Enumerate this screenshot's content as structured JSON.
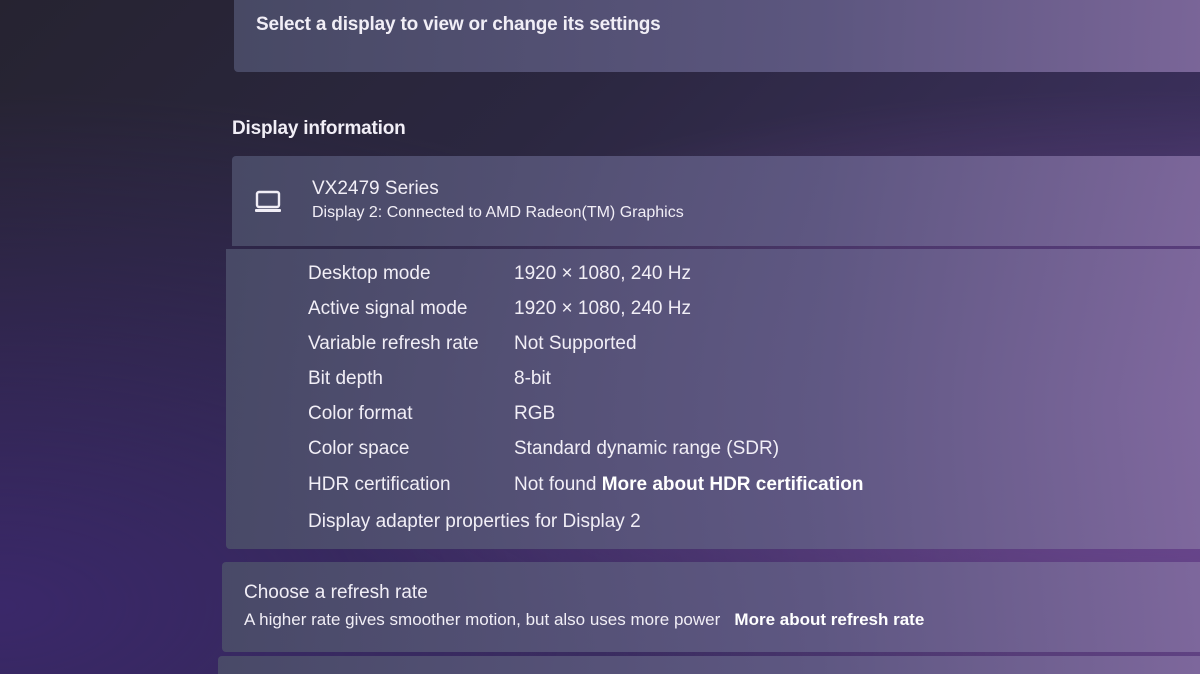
{
  "header": {
    "select_display_text": "Select a display to view or change its settings"
  },
  "display_info": {
    "heading": "Display information",
    "monitor": {
      "icon": "monitor-icon",
      "name": "VX2479 Series",
      "connection": "Display 2: Connected to AMD Radeon(TM) Graphics"
    },
    "rows": [
      {
        "label": "Desktop mode",
        "value": "1920 × 1080, 240 Hz"
      },
      {
        "label": "Active signal mode",
        "value": "1920 × 1080, 240 Hz"
      },
      {
        "label": "Variable refresh rate",
        "value": "Not Supported"
      },
      {
        "label": "Bit depth",
        "value": "8-bit"
      },
      {
        "label": "Color format",
        "value": "RGB"
      },
      {
        "label": "Color space",
        "value": "Standard dynamic range (SDR)"
      },
      {
        "label": "HDR certification",
        "value": "Not found",
        "link": "More about HDR certification"
      }
    ],
    "adapter_link": "Display adapter properties for Display 2"
  },
  "refresh": {
    "title": "Choose a refresh rate",
    "description": "A higher rate gives smoother motion, but also uses more power",
    "link": "More about refresh rate"
  }
}
